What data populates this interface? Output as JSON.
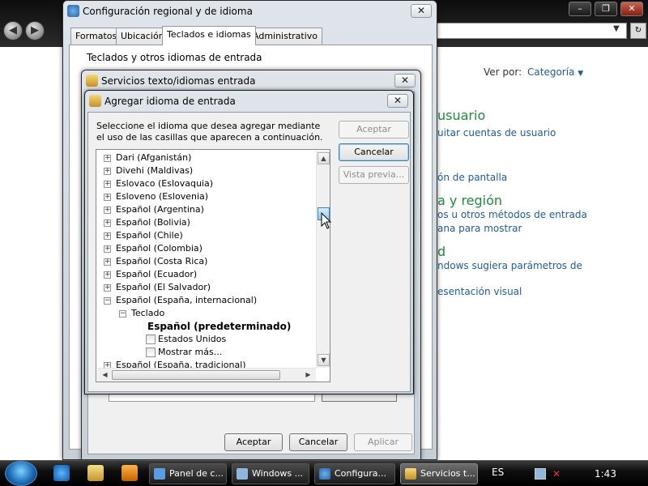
{
  "background_window": {
    "title_buttons": [
      "–",
      "❐",
      "✕"
    ],
    "view_label": "Ver por:",
    "view_value": "Categoría",
    "view_arrow": "▼",
    "links": [
      {
        "id": "usuario",
        "text": "usuario",
        "style": "heading"
      },
      {
        "id": "uitar",
        "text": "uitar cuentas de usuario",
        "style": "link"
      },
      {
        "id": "pantalla",
        "text": "ón de pantalla",
        "style": "link"
      },
      {
        "id": "region",
        "text": "a y región",
        "style": "heading"
      },
      {
        "id": "metodos",
        "text": "os u otros métodos de entrada",
        "style": "link"
      },
      {
        "id": "mostrar",
        "text": "ana para mostrar",
        "style": "link"
      },
      {
        "id": "d",
        "text": "d",
        "style": "heading"
      },
      {
        "id": "windows",
        "text": "ndows sugiera parámetros de",
        "style": "link"
      },
      {
        "id": "visual",
        "text": "esentación visual",
        "style": "link"
      }
    ]
  },
  "regional_dialog": {
    "title": "Configuración regional y de idioma",
    "close": "✕",
    "tabs": [
      "Formatos",
      "Ubicación",
      "Teclados e idiomas",
      "Administrativo"
    ],
    "active_tab": 2,
    "group_label": "Teclados y otros idiomas de entrada"
  },
  "services_dialog": {
    "title": "Servicios texto/idiomas entrada",
    "close": "✕",
    "buttons": {
      "ok": "Aceptar",
      "cancel": "Cancelar",
      "apply": "Aplicar"
    }
  },
  "add_dialog": {
    "title": "Agregar idioma de entrada",
    "close": "✕",
    "instructions": "Seleccione el idioma que desea agregar mediante el uso de las casillas que aparecen a continuación.",
    "buttons": {
      "ok": "Aceptar",
      "cancel": "Cancelar",
      "preview": "Vista previa..."
    },
    "tree": [
      {
        "label": "Dari (Afganistán)",
        "kind": "lang"
      },
      {
        "label": "Divehi (Maldivas)",
        "kind": "lang"
      },
      {
        "label": "Eslovaco (Eslovaquia)",
        "kind": "lang"
      },
      {
        "label": "Esloveno (Eslovenia)",
        "kind": "lang"
      },
      {
        "label": "Español (Argentina)",
        "kind": "lang"
      },
      {
        "label": "Español (Bolivia)",
        "kind": "lang"
      },
      {
        "label": "Español (Chile)",
        "kind": "lang"
      },
      {
        "label": "Español (Colombia)",
        "kind": "lang"
      },
      {
        "label": "Español (Costa Rica)",
        "kind": "lang"
      },
      {
        "label": "Español (Ecuador)",
        "kind": "lang"
      },
      {
        "label": "Español (El Salvador)",
        "kind": "lang"
      },
      {
        "label": "Español (España, internacional)",
        "kind": "lang-open"
      },
      {
        "label": "Teclado",
        "kind": "group"
      },
      {
        "label": "Español (predeterminado)",
        "kind": "default"
      },
      {
        "label": "Estados Unidos",
        "kind": "check"
      },
      {
        "label": "Mostrar más...",
        "kind": "check"
      },
      {
        "label": "Español (España, tradicional)",
        "kind": "lang"
      }
    ],
    "expand_symbol": "+",
    "collapse_symbol": "−",
    "scroll_up": "▲",
    "scroll_down": "▼",
    "scroll_left": "◀",
    "scroll_right": "▶"
  },
  "taskbar": {
    "items": [
      "Panel de c...",
      "Windows ...",
      "Configura...",
      "Servicios t..."
    ],
    "active_item": 3,
    "language": "ES",
    "clock": "1:43"
  },
  "colors": {
    "link": "#1e5c9a",
    "heading": "#1f8a3c"
  }
}
